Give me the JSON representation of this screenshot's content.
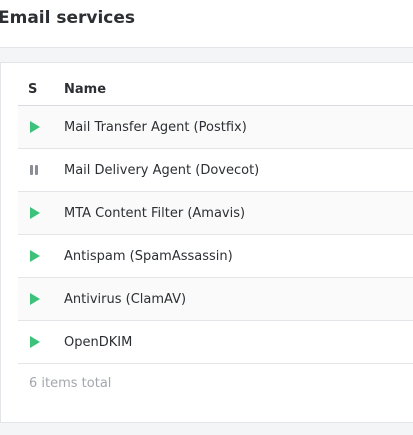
{
  "page": {
    "title": "Email services"
  },
  "table": {
    "columns": {
      "status": "S",
      "name": "Name"
    },
    "rows": [
      {
        "status": "running",
        "status_icon": "play-icon",
        "name": "Mail Transfer Agent (Postfix)"
      },
      {
        "status": "paused",
        "status_icon": "pause-icon",
        "name": "Mail Delivery Agent (Dovecot)"
      },
      {
        "status": "running",
        "status_icon": "play-icon",
        "name": "MTA Content Filter (Amavis)"
      },
      {
        "status": "running",
        "status_icon": "play-icon",
        "name": "Antispam (SpamAssassin)"
      },
      {
        "status": "running",
        "status_icon": "play-icon",
        "name": "Antivirus (ClamAV)"
      },
      {
        "status": "running",
        "status_icon": "play-icon",
        "name": "OpenDKIM"
      }
    ],
    "footer": "6 items total"
  },
  "colors": {
    "running": "#3cc27a",
    "paused": "#8a8f96"
  }
}
